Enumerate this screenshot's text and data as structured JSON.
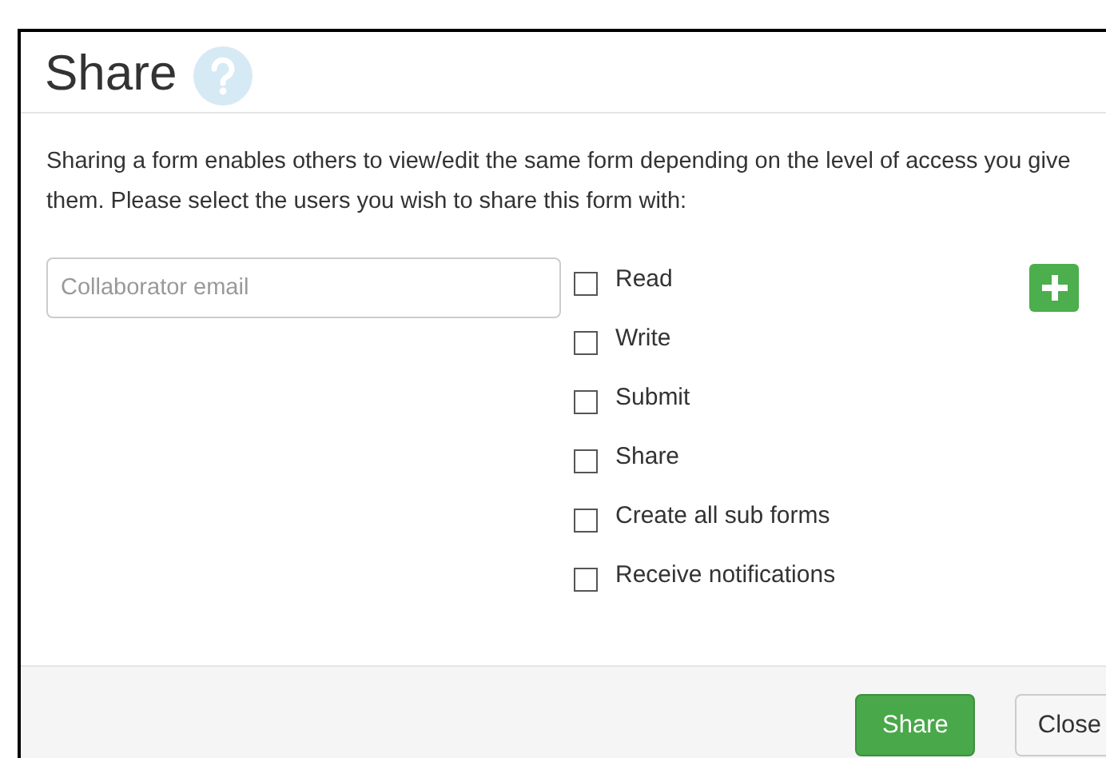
{
  "dialog": {
    "title": "Share",
    "description": "Sharing a form enables others to view/edit the same form depending on the level of access you give them. Please select the users you wish to share this form with:",
    "email_field": {
      "placeholder": "Collaborator email"
    },
    "permissions": [
      {
        "label": "Read",
        "checked": false
      },
      {
        "label": "Write",
        "checked": false
      },
      {
        "label": "Submit",
        "checked": false
      },
      {
        "label": "Share",
        "checked": false
      },
      {
        "label": "Create all sub forms",
        "checked": false
      },
      {
        "label": "Receive notifications",
        "checked": false
      }
    ],
    "buttons": [
      {
        "label": "Share",
        "kind": "primary"
      },
      {
        "label": "Close",
        "kind": "default"
      }
    ]
  }
}
